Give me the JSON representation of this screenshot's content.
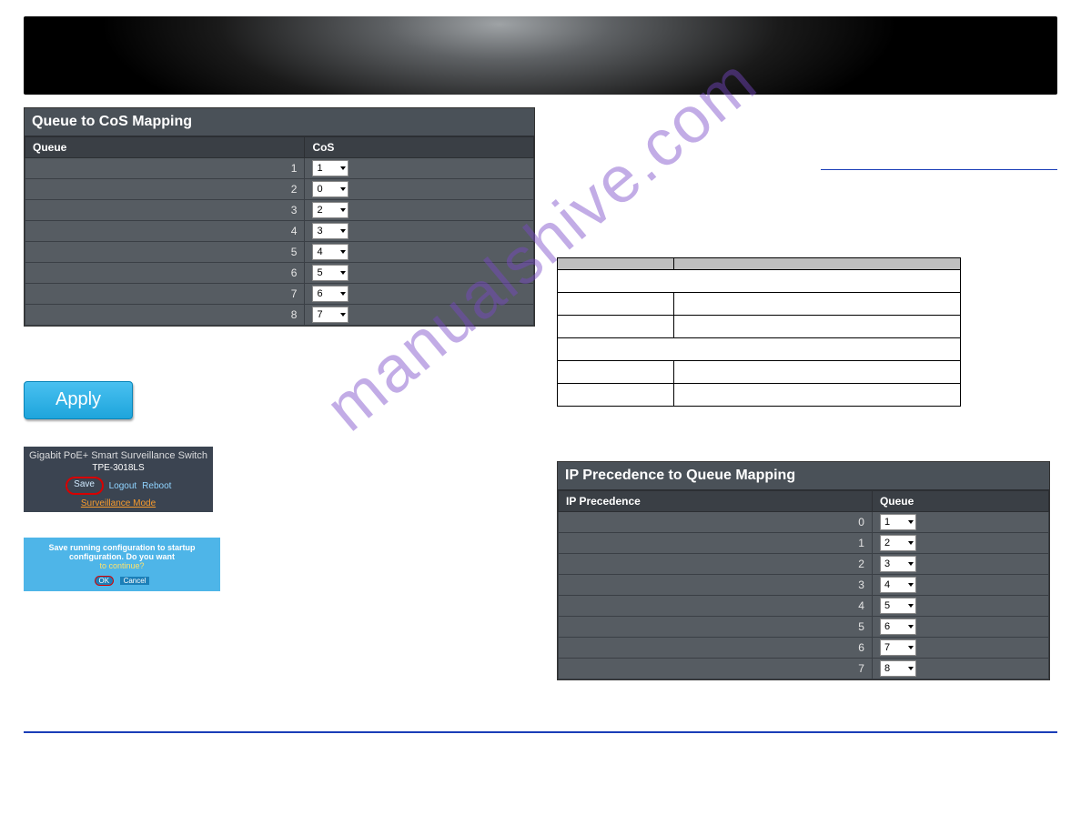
{
  "watermark": "manualshive.com",
  "left": {
    "panel1_title": "Queue to CoS Mapping",
    "panel1_headers": {
      "queue": "Queue",
      "cos": "CoS"
    },
    "queue_rows": [
      {
        "queue": "1",
        "cos": "1"
      },
      {
        "queue": "2",
        "cos": "0"
      },
      {
        "queue": "3",
        "cos": "2"
      },
      {
        "queue": "4",
        "cos": "3"
      },
      {
        "queue": "5",
        "cos": "4"
      },
      {
        "queue": "6",
        "cos": "5"
      },
      {
        "queue": "7",
        "cos": "6"
      },
      {
        "queue": "8",
        "cos": "7"
      }
    ],
    "apply_label": "Apply",
    "savebox": {
      "title": "Gigabit PoE+ Smart Surveillance Switch",
      "model": "TPE-3018LS",
      "save": "Save",
      "logout": "Logout",
      "reboot": "Reboot",
      "mode": "Surveillance Mode"
    },
    "confirm": {
      "text": "Save running configuration to startup configuration. Do you want",
      "continue": "to continue?",
      "ok": "OK",
      "cancel": "Cancel"
    }
  },
  "right": {
    "spec_headers": {
      "c0": "",
      "c1": ""
    },
    "spec_rows": [
      {
        "a": "",
        "b": ""
      },
      {
        "a": "",
        "b": ""
      },
      {
        "a": "",
        "b": ""
      },
      {
        "a": "",
        "b": "",
        "span": "2"
      },
      {
        "a": "",
        "b": ""
      },
      {
        "a": "",
        "b": ""
      }
    ],
    "panel2_title": "IP Precedence to Queue Mapping",
    "panel2_headers": {
      "ipp": "IP Precedence",
      "queue": "Queue"
    },
    "ipp_rows": [
      {
        "ipp": "0",
        "queue": "1"
      },
      {
        "ipp": "1",
        "queue": "2"
      },
      {
        "ipp": "2",
        "queue": "3"
      },
      {
        "ipp": "3",
        "queue": "4"
      },
      {
        "ipp": "4",
        "queue": "5"
      },
      {
        "ipp": "5",
        "queue": "6"
      },
      {
        "ipp": "6",
        "queue": "7"
      },
      {
        "ipp": "7",
        "queue": "8"
      }
    ]
  }
}
